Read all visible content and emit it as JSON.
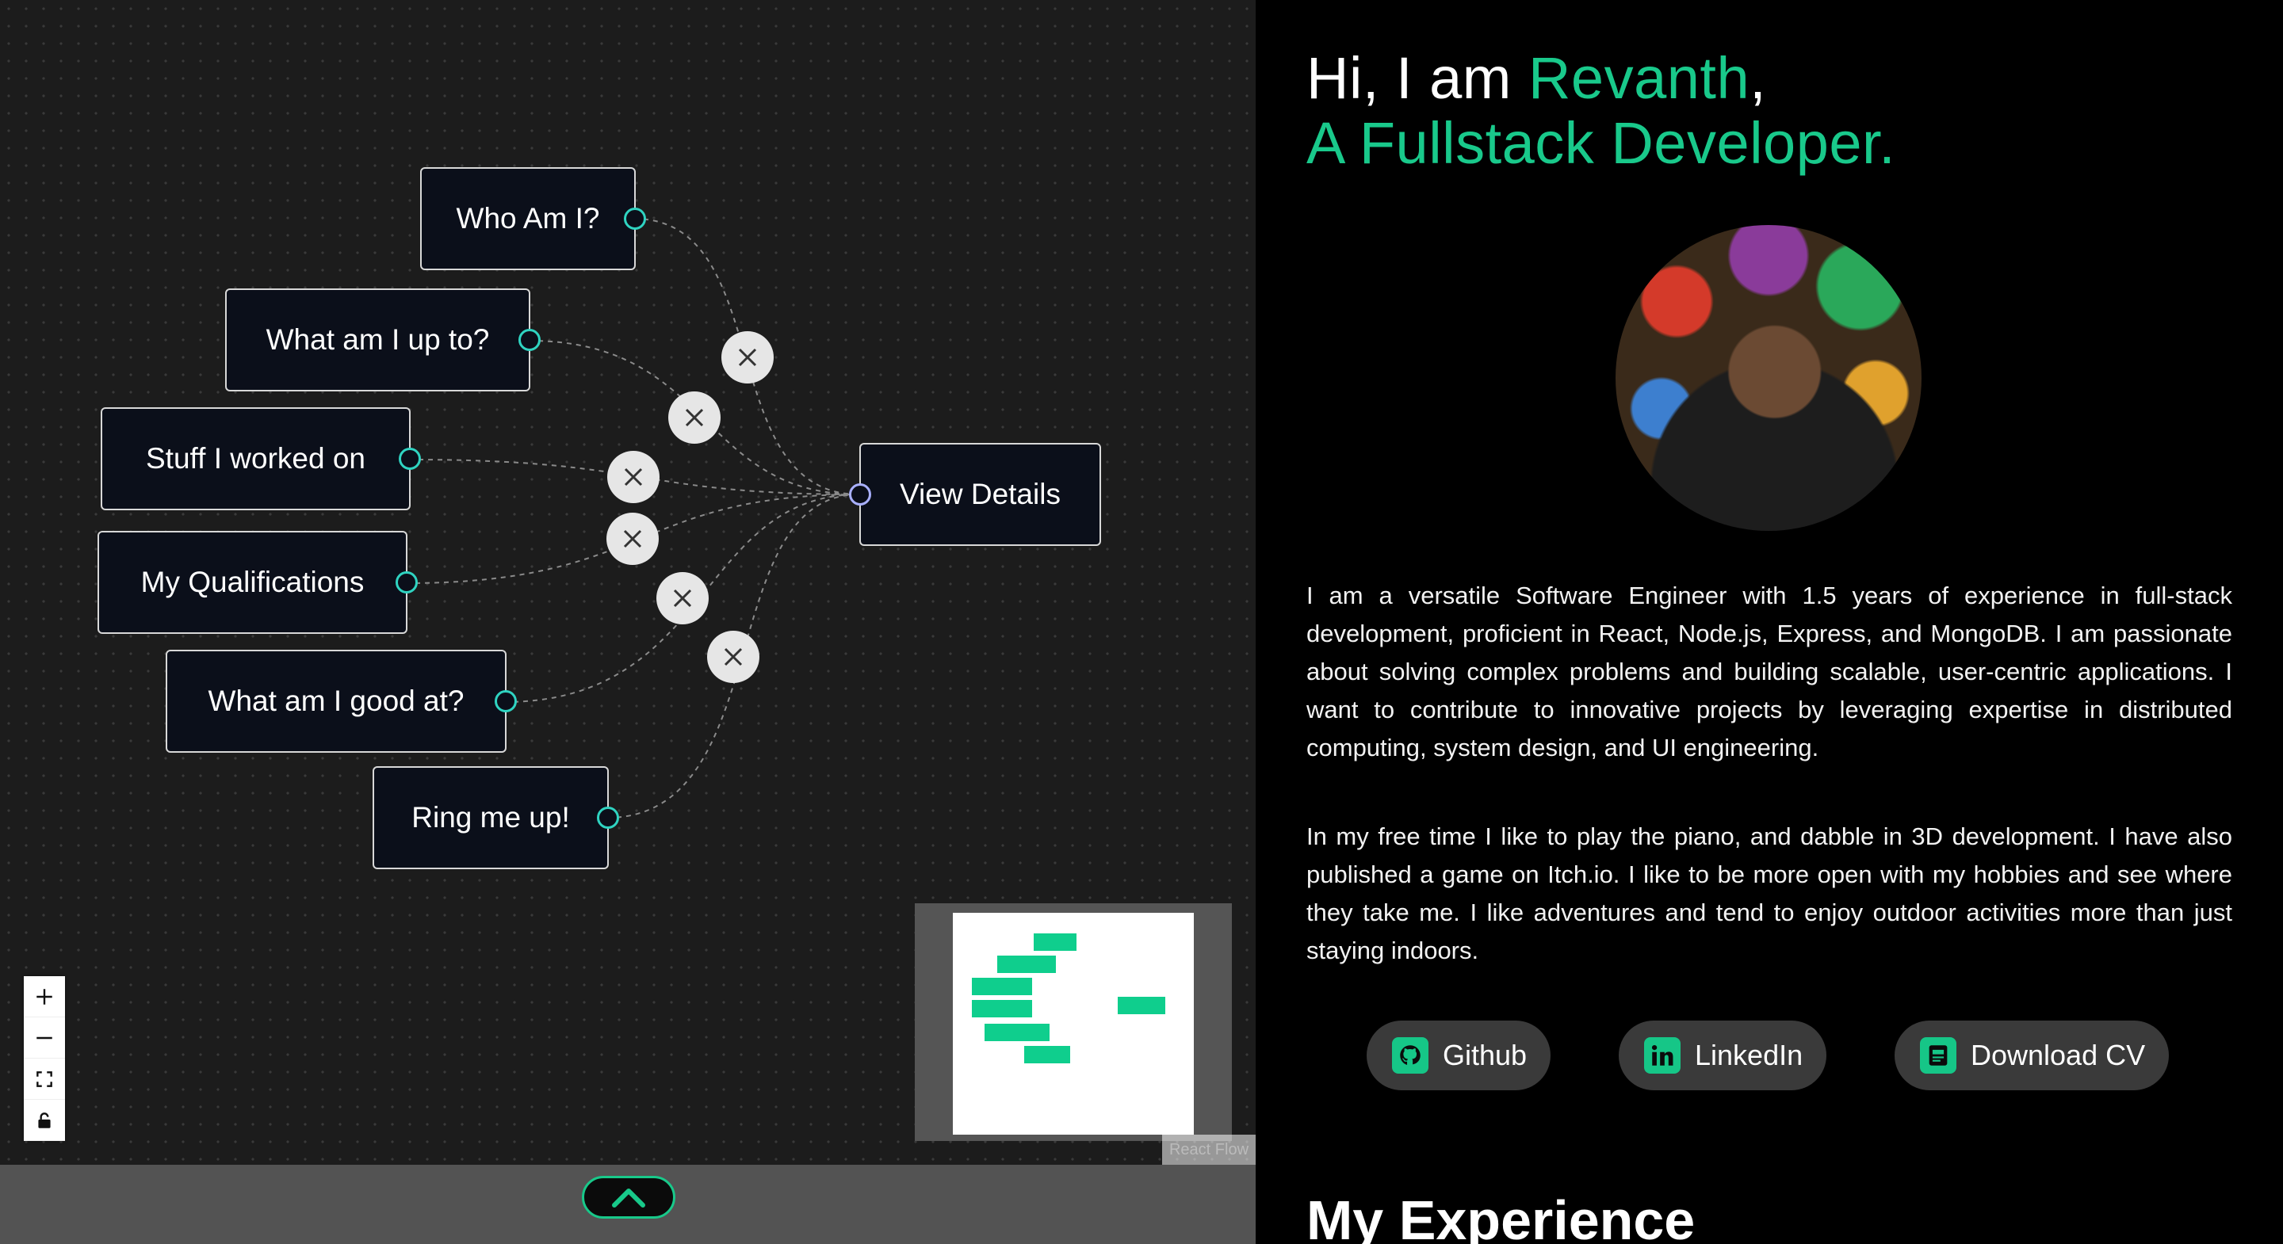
{
  "flow": {
    "nodes": [
      {
        "id": "who",
        "label": "Who Am I?"
      },
      {
        "id": "upto",
        "label": "What am I up to?"
      },
      {
        "id": "worked",
        "label": "Stuff I worked on"
      },
      {
        "id": "quals",
        "label": "My Qualifications"
      },
      {
        "id": "good",
        "label": "What am I good at?"
      },
      {
        "id": "ring",
        "label": "Ring me up!"
      },
      {
        "id": "details",
        "label": "View Details"
      }
    ],
    "attribution": "React Flow",
    "controls": [
      "zoom-in",
      "zoom-out",
      "fit-view",
      "lock"
    ]
  },
  "hero": {
    "greeting": "Hi, I am ",
    "name": "Revanth",
    "comma": ",",
    "role": "A Fullstack Developer."
  },
  "about": {
    "para1": "I am a versatile Software Engineer with 1.5 years of experience in full-stack development, proficient in React, Node.js, Express, and MongoDB. I am passionate about solving complex problems and building scalable, user-centric applications. I want to contribute to innovative projects by leveraging expertise in distributed computing, system design, and UI engineering.",
    "para2": "In my free time I like to play the piano, and dabble in 3D development. I have also published a game on Itch.io. I like to be more open with my hobbies and see where they take me. I like adventures and tend to enjoy outdoor activities more than just staying indoors."
  },
  "links": {
    "github": "Github",
    "linkedin": "LinkedIn",
    "cv": "Download CV"
  },
  "sections": {
    "experience": "My Experience"
  },
  "colors": {
    "accent": "#19c98b",
    "handle": "#2fd3c1"
  }
}
